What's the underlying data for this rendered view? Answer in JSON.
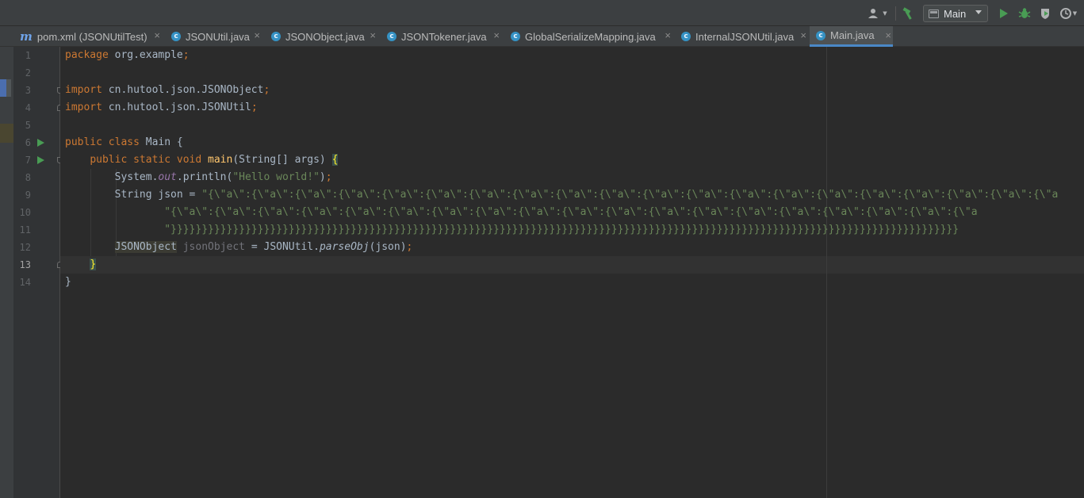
{
  "toolbar": {
    "run_config_label": "Main",
    "icons": [
      "user-icon",
      "hammer-icon",
      "run-icon",
      "debug-icon",
      "coverage-icon",
      "profiler-icon"
    ],
    "colors": {
      "run": "#499c54",
      "hammer": "#499c54",
      "accent": "#4a88c7"
    }
  },
  "tabs": [
    {
      "label": "pom.xml (JSONUtilTest)",
      "icon": "maven-icon",
      "active": false
    },
    {
      "label": "JSONUtil.java",
      "icon": "class-icon",
      "active": false
    },
    {
      "label": "JSONObject.java",
      "icon": "class-icon",
      "active": false
    },
    {
      "label": "JSONTokener.java",
      "icon": "class-icon",
      "active": false
    },
    {
      "label": "GlobalSerializeMapping.java",
      "icon": "class-icon",
      "active": false
    },
    {
      "label": "InternalJSONUtil.java",
      "icon": "class-icon",
      "active": false
    },
    {
      "label": "Main.java",
      "icon": "class-icon",
      "active": true
    }
  ],
  "close_glyph": "×",
  "editor": {
    "current_line": 13,
    "lines": [
      {
        "num": "1",
        "parts": [
          [
            "kw",
            "package"
          ],
          [
            "pkg",
            " org.example"
          ],
          [
            "kw",
            ";"
          ]
        ]
      },
      {
        "num": "2",
        "parts": []
      },
      {
        "num": "3",
        "parts": [
          [
            "kw",
            "import"
          ],
          [
            "pkg",
            " cn.hutool.json.JSONObject"
          ],
          [
            "kw",
            ";"
          ]
        ]
      },
      {
        "num": "4",
        "parts": [
          [
            "kw",
            "import"
          ],
          [
            "pkg",
            " cn.hutool.json.JSONUtil"
          ],
          [
            "kw",
            ";"
          ]
        ]
      },
      {
        "num": "5",
        "parts": []
      },
      {
        "num": "6",
        "parts": [
          [
            "kw",
            "public class"
          ],
          [
            "pkg",
            " Main {"
          ]
        ]
      },
      {
        "num": "7",
        "parts": [
          [
            "pkg",
            "    "
          ],
          [
            "kw",
            "public static void"
          ],
          [
            "pkg",
            " "
          ],
          [
            "mth",
            "main"
          ],
          [
            "pkg",
            "(String[] args) "
          ],
          [
            "brace-match",
            "{"
          ]
        ]
      },
      {
        "num": "8",
        "parts": [
          [
            "pkg",
            "        System."
          ],
          [
            "fld",
            "out"
          ],
          [
            "pkg",
            ".println("
          ],
          [
            "str",
            "\"Hello world!\""
          ],
          [
            "pkg",
            ")"
          ],
          [
            "kw",
            ";"
          ]
        ]
      },
      {
        "num": "9",
        "parts": [
          [
            "pkg",
            "        String json = "
          ],
          [
            "str",
            "\"{\\\"a\\\":{\\\"a\\\":{\\\"a\\\":{\\\"a\\\":{\\\"a\\\":{\\\"a\\\":{\\\"a\\\":{\\\"a\\\":{\\\"a\\\":{\\\"a\\\":{\\\"a\\\":{\\\"a\\\":{\\\"a\\\":{\\\"a\\\":{\\\"a\\\":{\\\"a\\\":{\\\"a\\\":{\\\"a\\\":{\\\"a\\\":{\\\"a"
          ]
        ]
      },
      {
        "num": "10",
        "parts": [
          [
            "pkg",
            "                "
          ],
          [
            "str",
            "\"{\\\"a\\\":{\\\"a\\\":{\\\"a\\\":{\\\"a\\\":{\\\"a\\\":{\\\"a\\\":{\\\"a\\\":{\\\"a\\\":{\\\"a\\\":{\\\"a\\\":{\\\"a\\\":{\\\"a\\\":{\\\"a\\\":{\\\"a\\\":{\\\"a\\\":{\\\"a\\\":{\\\"a\\\":{\\\"a\\\":{\\\"a"
          ]
        ]
      },
      {
        "num": "11",
        "parts": [
          [
            "pkg",
            "                "
          ],
          [
            "str",
            "\"}}}}}}}}}}}}}}}}}}}}}}}}}}}}}}}}}}}}}}}}}}}}}}}}}}}}}}}}}}}}}}}}}}}}}}}}}}}}}}}}}}}}}}}}}}}}}}}}}}}}}}}}}}}}}}}}}}}}}}}}}}}}}}}"
          ]
        ]
      },
      {
        "num": "12",
        "parts": [
          [
            "pkg",
            "        "
          ],
          [
            "hl-class",
            "JSONObject"
          ],
          [
            "pkg",
            " "
          ],
          [
            "unused",
            "jsonObject"
          ],
          [
            "pkg",
            " = JSONUtil."
          ],
          [
            "it",
            "parseObj"
          ],
          [
            "pkg",
            "(json)"
          ],
          [
            "kw",
            ";"
          ]
        ]
      },
      {
        "num": "13",
        "parts": [
          [
            "pkg",
            "    "
          ],
          [
            "brace-match",
            "}"
          ]
        ]
      },
      {
        "num": "14",
        "parts": [
          [
            "pkg",
            "}"
          ]
        ]
      }
    ]
  }
}
